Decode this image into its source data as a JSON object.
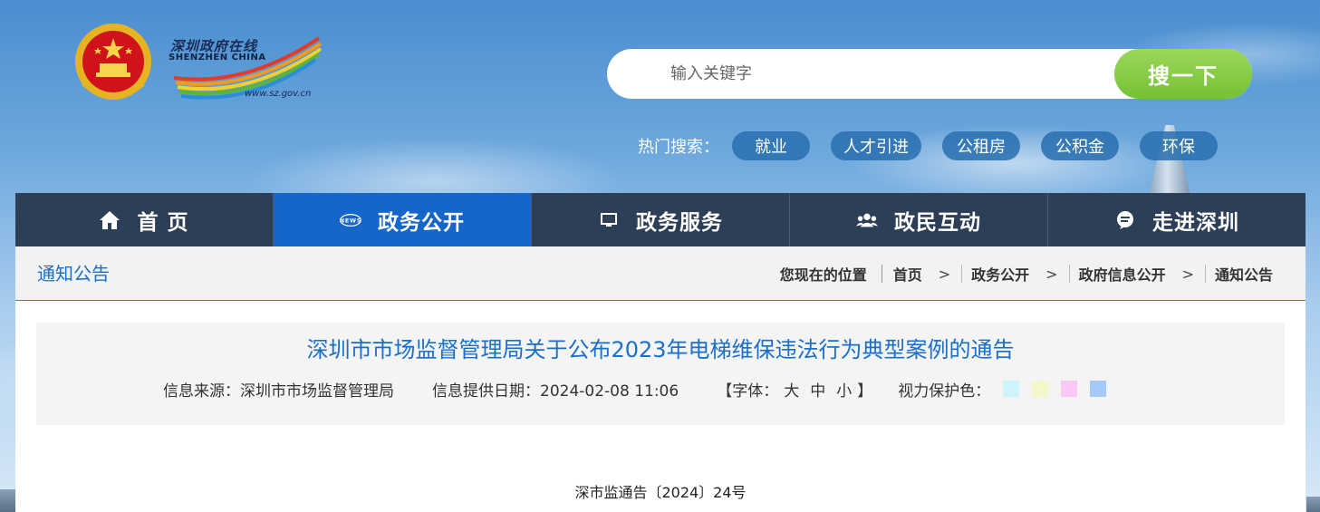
{
  "header": {
    "logo_cn": "深圳政府在线",
    "logo_en": "SHENZHEN CHINA",
    "logo_url": "www.sz.gov.cn"
  },
  "search": {
    "placeholder": "输入关键字",
    "button_label": "搜一下"
  },
  "hot_search": {
    "label": "热门搜索：",
    "tags": [
      "就业",
      "人才引进",
      "公租房",
      "公积金",
      "环保"
    ]
  },
  "nav": {
    "items": [
      {
        "label": "首 页",
        "icon": "home-icon"
      },
      {
        "label": "政务公开",
        "icon": "news-icon"
      },
      {
        "label": "政务服务",
        "icon": "monitor-icon"
      },
      {
        "label": "政民互动",
        "icon": "people-icon"
      },
      {
        "label": "走进深圳",
        "icon": "chat-icon"
      }
    ],
    "active_index": 1
  },
  "breadcrumb": {
    "section_title": "通知公告",
    "location_label": "您现在的位置",
    "items": [
      "首页",
      "政务公开",
      "政府信息公开",
      "通知公告"
    ]
  },
  "article": {
    "title": "深圳市市场监督管理局关于公布2023年电梯维保违法行为典型案例的通告",
    "source": "信息来源：深圳市市场监督管理局",
    "date": "信息提供日期：2024-02-08 11:06",
    "font_label_open": "【字体：",
    "font_sizes": [
      "大",
      "中",
      "小"
    ],
    "font_label_close": "】",
    "eye_label": "视力保护色：",
    "eye_colors": [
      "#cdf3fb",
      "#f4f7c8",
      "#fbc7f4",
      "#a3c9f7"
    ],
    "doc_number": "深市监通告〔2024〕24号"
  },
  "colors": {
    "accent_blue": "#1566c8",
    "nav_bg": "#2d3e57",
    "search_green": "#8ccf4a",
    "title_blue": "#1a6fc9"
  }
}
